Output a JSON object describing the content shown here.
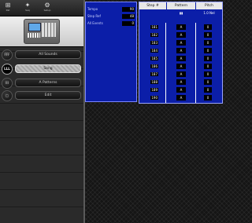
{
  "toolbar": {
    "items": [
      {
        "icon": "⊞",
        "label": "Pat"
      },
      {
        "icon": "✦",
        "label": "Seq"
      },
      {
        "icon": "⚙",
        "label": "Setup"
      }
    ]
  },
  "nav": {
    "items": [
      {
        "badge": "FFF",
        "label": "All Sounds",
        "active": false
      },
      {
        "badge": "LLL",
        "label": "Song",
        "active": true
      },
      {
        "badge": "III",
        "label": "A Patterns",
        "active": false
      },
      {
        "badge": "□",
        "label": "Edit",
        "active": false
      }
    ]
  },
  "song_settings": {
    "rows": [
      {
        "label": "Tempo",
        "value": "90"
      },
      {
        "label": "Step Ref",
        "value": "48"
      },
      {
        "label": "All Events",
        "value": "0"
      }
    ]
  },
  "grid": {
    "headers": {
      "step": "Step #",
      "pattern": "Pattern",
      "pitch": "Pitch"
    },
    "subheaders": {
      "pattern": "▮▮",
      "pitch": "1.0 Nel"
    },
    "rows": [
      {
        "step": "181",
        "pattern": "A",
        "pitch": "0"
      },
      {
        "step": "182",
        "pattern": "A",
        "pitch": "0"
      },
      {
        "step": "183",
        "pattern": "A",
        "pitch": "0"
      },
      {
        "step": "184",
        "pattern": "A",
        "pitch": "0"
      },
      {
        "step": "185",
        "pattern": "A",
        "pitch": "0"
      },
      {
        "step": "186",
        "pattern": "A",
        "pitch": "0"
      },
      {
        "step": "187",
        "pattern": "A",
        "pitch": "0"
      },
      {
        "step": "188",
        "pattern": "A",
        "pitch": "0"
      },
      {
        "step": "189",
        "pattern": "A",
        "pitch": "0"
      },
      {
        "step": "190",
        "pattern": "A",
        "pitch": "0"
      }
    ]
  },
  "colors": {
    "panel_blue": "#0b1ea8",
    "active_pill": "#bdbdbd",
    "workspace_bg": "#151515"
  }
}
